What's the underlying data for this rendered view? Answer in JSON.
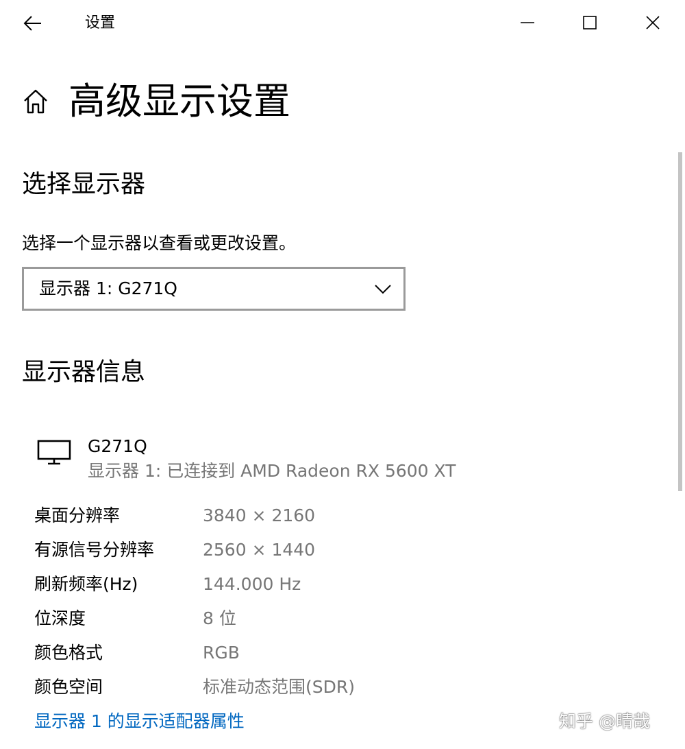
{
  "window": {
    "title": "设置",
    "back_icon": "arrow-left-icon",
    "minimize_icon": "minimize-icon",
    "maximize_icon": "maximize-icon",
    "close_icon": "close-icon"
  },
  "page": {
    "home_icon": "home-icon",
    "title": "高级显示设置"
  },
  "select_display": {
    "heading": "选择显示器",
    "description": "选择一个显示器以查看或更改设置。",
    "dropdown_value": "显示器 1: G271Q"
  },
  "display_info": {
    "heading": "显示器信息",
    "monitor_icon": "monitor-icon",
    "monitor_name": "G271Q",
    "monitor_status": "显示器 1: 已连接到 AMD Radeon RX 5600 XT",
    "rows": [
      {
        "key": "桌面分辨率",
        "value": "3840 × 2160"
      },
      {
        "key": "有源信号分辨率",
        "value": "2560 × 1440"
      },
      {
        "key": "刷新频率(Hz)",
        "value": "144.000 Hz"
      },
      {
        "key": "位深度",
        "value": "8 位"
      },
      {
        "key": "颜色格式",
        "value": "RGB"
      },
      {
        "key": "颜色空间",
        "value": "标准动态范围(SDR)"
      }
    ],
    "adapter_link": "显示器 1 的显示适配器属性"
  },
  "watermark": "知乎 @晴哉",
  "colors": {
    "link": "#0067c0",
    "secondary_text": "#767676",
    "dropdown_border": "#9a9a9a"
  }
}
